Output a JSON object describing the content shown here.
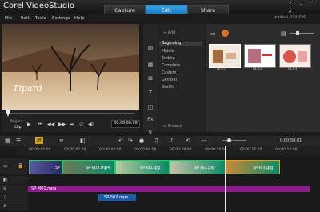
{
  "app": {
    "title": "Corel VideoStudio"
  },
  "tabs": [
    "Capture",
    "Edit",
    "Share"
  ],
  "project_info": "Untitled, 720*576",
  "menu": [
    "File",
    "Edit",
    "Tools",
    "Settings",
    "Help"
  ],
  "preview": {
    "watermark": "Tipard",
    "mode_project": "Project",
    "mode_clip": "Clip",
    "timecode": "00:00:00:00"
  },
  "library": {
    "add_label": "Add",
    "categories": [
      "Beginning",
      "Middle",
      "Ending",
      "Complete",
      "Custom",
      "General",
      "Graffiti"
    ],
    "browse_label": "Browse",
    "thumbs": [
      "IP-01",
      "IP-02",
      "IP-03"
    ]
  },
  "timeline": {
    "ruler": [
      "00:00:00:00",
      "00:00:02:00",
      "00:00:04:00",
      "00:00:06:00",
      "00:00:08:00",
      "00:00:10:00",
      "00:00:12:00",
      "00:00:14:00"
    ],
    "zoom_time": "0:00:50:01",
    "video_clips": [
      "SP",
      "SP-V03.mp4",
      "SP-I01.jpg",
      "SP-I02.jpg",
      "SP-I03.jpg"
    ],
    "audio_clips": [
      "SP-M01.mpa",
      "SP-S02.mpa"
    ]
  },
  "colors": {
    "accent": "#1f8fe0",
    "audio_track": "#8c1c8c"
  }
}
